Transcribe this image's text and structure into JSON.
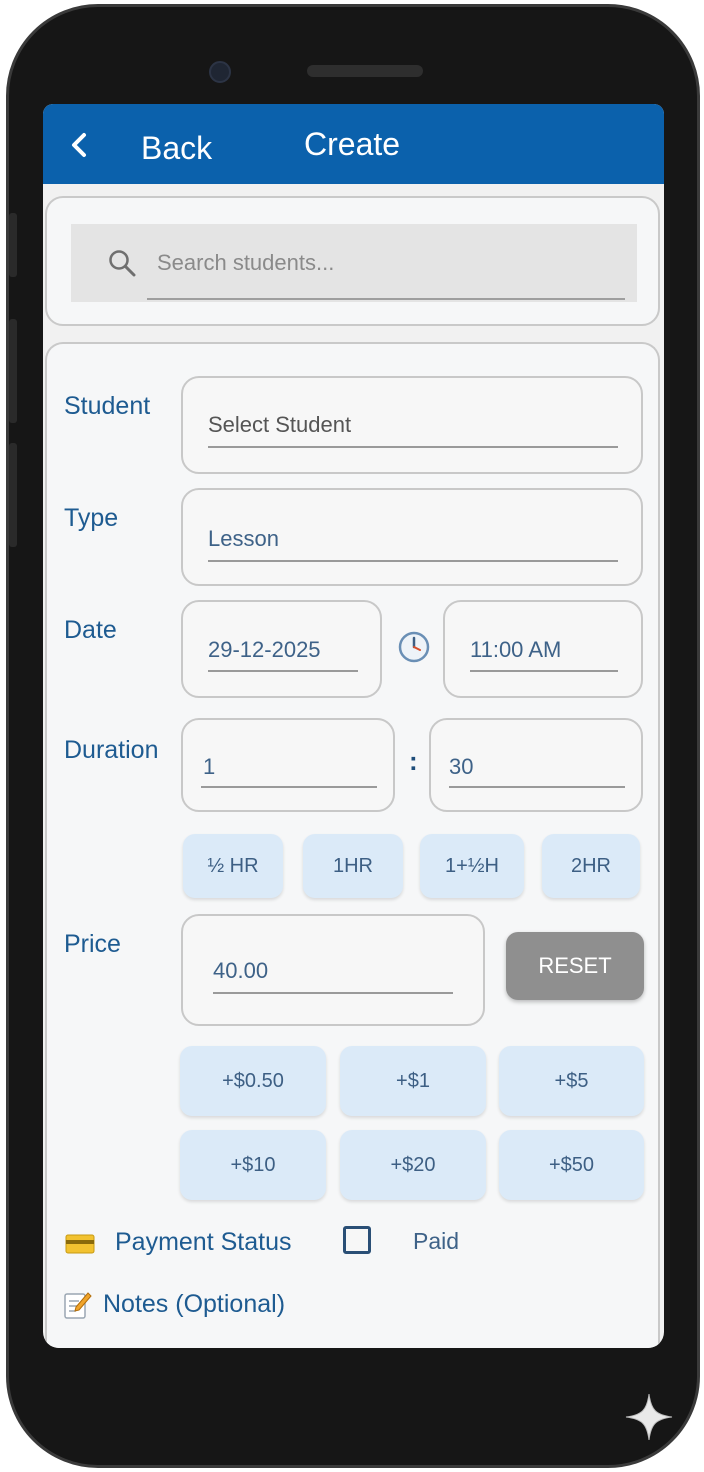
{
  "header": {
    "back_label": "Back",
    "title": "Create"
  },
  "search": {
    "placeholder": "Search students..."
  },
  "form": {
    "student": {
      "label": "Student",
      "value": "Select Student"
    },
    "type": {
      "label": "Type",
      "value": "Lesson"
    },
    "date": {
      "label": "Date",
      "date_value": "29-12-2025",
      "time_value": "11:00 AM"
    },
    "duration": {
      "label": "Duration",
      "hours": "1",
      "separator": ":",
      "minutes": "30",
      "presets": [
        "½ HR",
        "1HR",
        "1+½H",
        "2HR"
      ]
    },
    "price": {
      "label": "Price",
      "value": "40.00",
      "reset_label": "RESET",
      "increments": [
        "+$0.50",
        "+$1",
        "+$5",
        "+$10",
        "+$20",
        "+$50"
      ]
    },
    "payment": {
      "label": "Payment Status",
      "checkbox_label": "Paid",
      "paid": false
    },
    "notes": {
      "label": "Notes (Optional)"
    }
  },
  "icons": {
    "back": "chevron-left-icon",
    "search": "search-icon",
    "time": "clock-icon",
    "payment": "credit-card-icon",
    "notes": "memo-icon"
  },
  "colors": {
    "header": "#0b61ac",
    "label": "#1e5b91",
    "chip": "#dbeaf8",
    "reset": "#8f8f8f"
  }
}
